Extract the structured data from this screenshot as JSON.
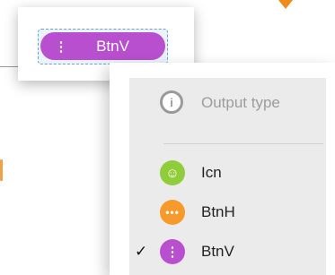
{
  "pill": {
    "label": "BtnV",
    "icon": "vertical-dots-icon",
    "color": "#b84fcf"
  },
  "menu": {
    "header": {
      "label": "Output type",
      "icon": "info-icon"
    },
    "items": [
      {
        "label": "Icn",
        "icon": "smiley-icon",
        "color": "#8fce3a",
        "selected": false
      },
      {
        "label": "BtnH",
        "icon": "horizontal-dots-icon",
        "color": "#f59a2b",
        "selected": false
      },
      {
        "label": "BtnV",
        "icon": "vertical-dots-icon",
        "color": "#b84fcf",
        "selected": true
      }
    ],
    "check_mark": "✓"
  }
}
